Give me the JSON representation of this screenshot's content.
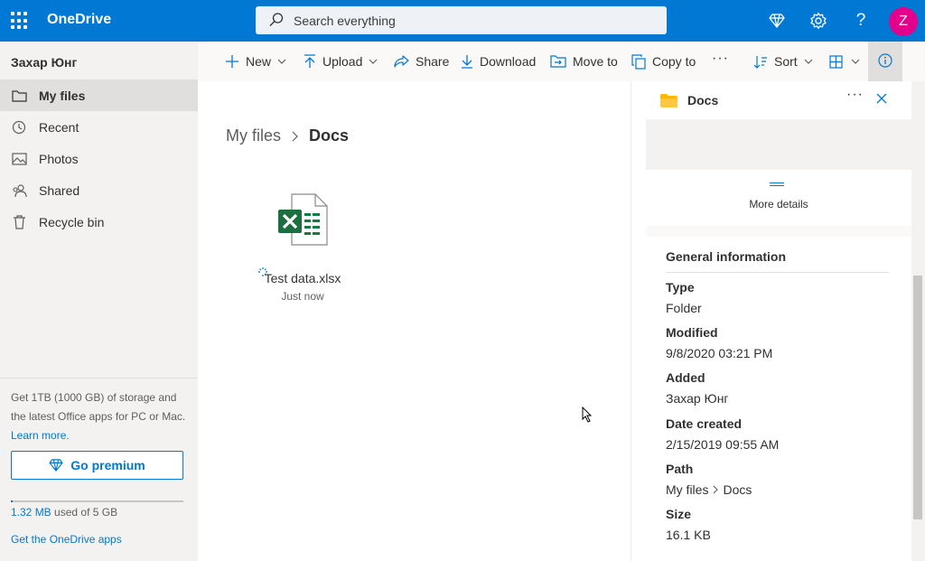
{
  "app": {
    "name": "OneDrive"
  },
  "search": {
    "placeholder": "Search everything"
  },
  "header": {
    "avatar_initial": "Z"
  },
  "sidebar": {
    "user_name": "Захар Юнг",
    "items": [
      {
        "label": "My files",
        "icon": "folder-icon",
        "active": true
      },
      {
        "label": "Recent",
        "icon": "clock-icon",
        "active": false
      },
      {
        "label": "Photos",
        "icon": "image-icon",
        "active": false
      },
      {
        "label": "Shared",
        "icon": "shared-people-icon",
        "active": false
      },
      {
        "label": "Recycle bin",
        "icon": "recycle-bin-icon",
        "active": false
      }
    ],
    "promo_text": "Get 1TB (1000 GB) of storage and the latest Office apps for PC or Mac.",
    "learn_more": "Learn more.",
    "premium_label": "Go premium",
    "quota_used": "1.32 MB",
    "quota_rest": " used of 5 GB",
    "quota_fraction": 0.0003,
    "apps_link": "Get the OneDrive apps"
  },
  "toolbar": {
    "new_label": "New",
    "upload_label": "Upload",
    "share_label": "Share",
    "download_label": "Download",
    "move_label": "Move to",
    "copy_label": "Copy to",
    "sort_label": "Sort"
  },
  "breadcrumb": {
    "root": "My files",
    "current": "Docs"
  },
  "files": [
    {
      "name": "Test data.xlsx",
      "modified": "Just now",
      "type": "excel"
    }
  ],
  "details": {
    "title": "Docs",
    "more_details": "More details",
    "section_title": "General information",
    "type_label": "Type",
    "type_value": "Folder",
    "modified_label": "Modified",
    "modified_value": "9/8/2020 03:21 PM",
    "added_label": "Added",
    "added_value": "Захар Юнг",
    "created_label": "Date created",
    "created_value": "2/15/2019 09:55 AM",
    "path_label": "Path",
    "path_root": "My files",
    "path_current": "Docs",
    "size_label": "Size",
    "size_value": "16.1 KB"
  },
  "colors": {
    "accent": "#0078d4",
    "avatar": "#e3008c",
    "excel": "#1d6f42"
  }
}
